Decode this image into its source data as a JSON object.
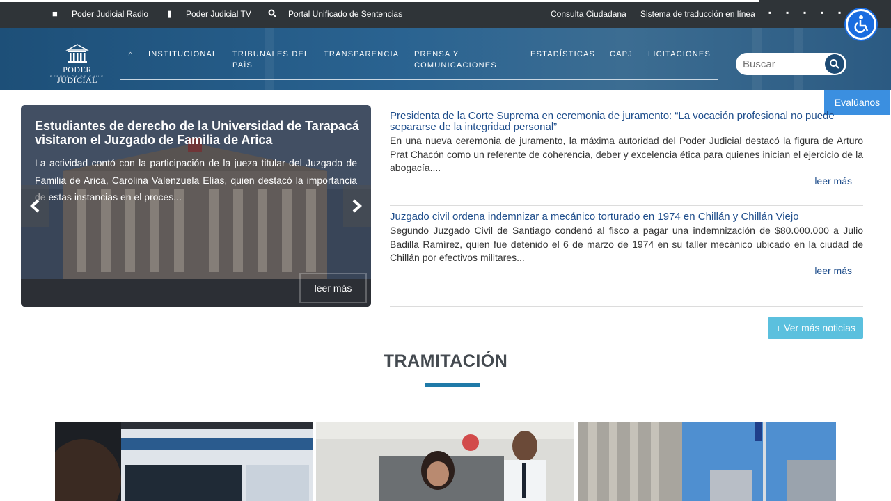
{
  "topbar": {
    "links": [
      "Poder Judicial Radio",
      "Poder Judicial TV",
      "Portal Unificado de Sentencias"
    ],
    "right_links": [
      "Consulta Ciudadana",
      "Sistema de traducción en línea"
    ],
    "icon_names": [
      "radio-icon",
      "mobile-icon",
      "search-icon"
    ],
    "social_icons": [
      "facebook-icon",
      "twitter-icon",
      "instagram-icon",
      "youtube-icon",
      "flickr-icon",
      "spotify-icon"
    ]
  },
  "header": {
    "logo_text": "PODER JUDICIAL",
    "logo_sub": "REPÚBLICA DE CHILE",
    "nav": [
      "INSTITUCIONAL",
      "TRIBUNALES DEL PAÍS",
      "TRANSPARENCIA",
      "PRENSA Y COMUNICACIONES",
      "ESTADÍSTICAS",
      "CAPJ",
      "LICITACIONES"
    ],
    "home_icon": "home-icon",
    "search_placeholder": "Buscar"
  },
  "evaluanos": "Evalúanos",
  "carousel": {
    "title": "Estudiantes de derecho de la Universidad de Tarapacá visitaron el Juzgado de Familia de Arica",
    "text": "La actividad contó con la participación de la jueza titular del Juzgado de Familia de Arica, Carolina Valenzuela Elías, quien destacó la importancia de estas instancias en el proces...",
    "more": "leer más"
  },
  "news": [
    {
      "title": "Presidenta de la Corte Suprema en ceremonia de juramento: “La vocación profesional no puede separarse de la integridad personal”",
      "body": "En una nueva ceremonia de juramento, la máxima autoridad del Poder Judicial destacó la figura de Arturo Prat Chacón como un referente de coherencia, deber y excelencia ética para quienes inician el ejercicio de la abogacía....",
      "more": "leer más "
    },
    {
      "title": "Juzgado civil ordena indemnizar a mecánico torturado en 1974 en Chillán y Chillán Viejo",
      "body": "Segundo Juzgado Civil de Santiago condenó al fisco a pagar una indemnización de $80.000.000 a Julio Badilla Ramírez, quien fue detenido el 6 de marzo de 1974 en su taller mecánico ubicado en la ciudad de Chillán por efectivos militares...",
      "more": "leer más "
    }
  ],
  "ver_mas": "+ Ver más noticias",
  "section_title": "TRAMITACIÓN",
  "colors": {
    "topbar": "#2f3438",
    "header": "#2a6391",
    "link": "#1f4e8c",
    "accent": "#1f7aa8",
    "ver_mas": "#5bc0de",
    "access": "#1a6ce0"
  }
}
